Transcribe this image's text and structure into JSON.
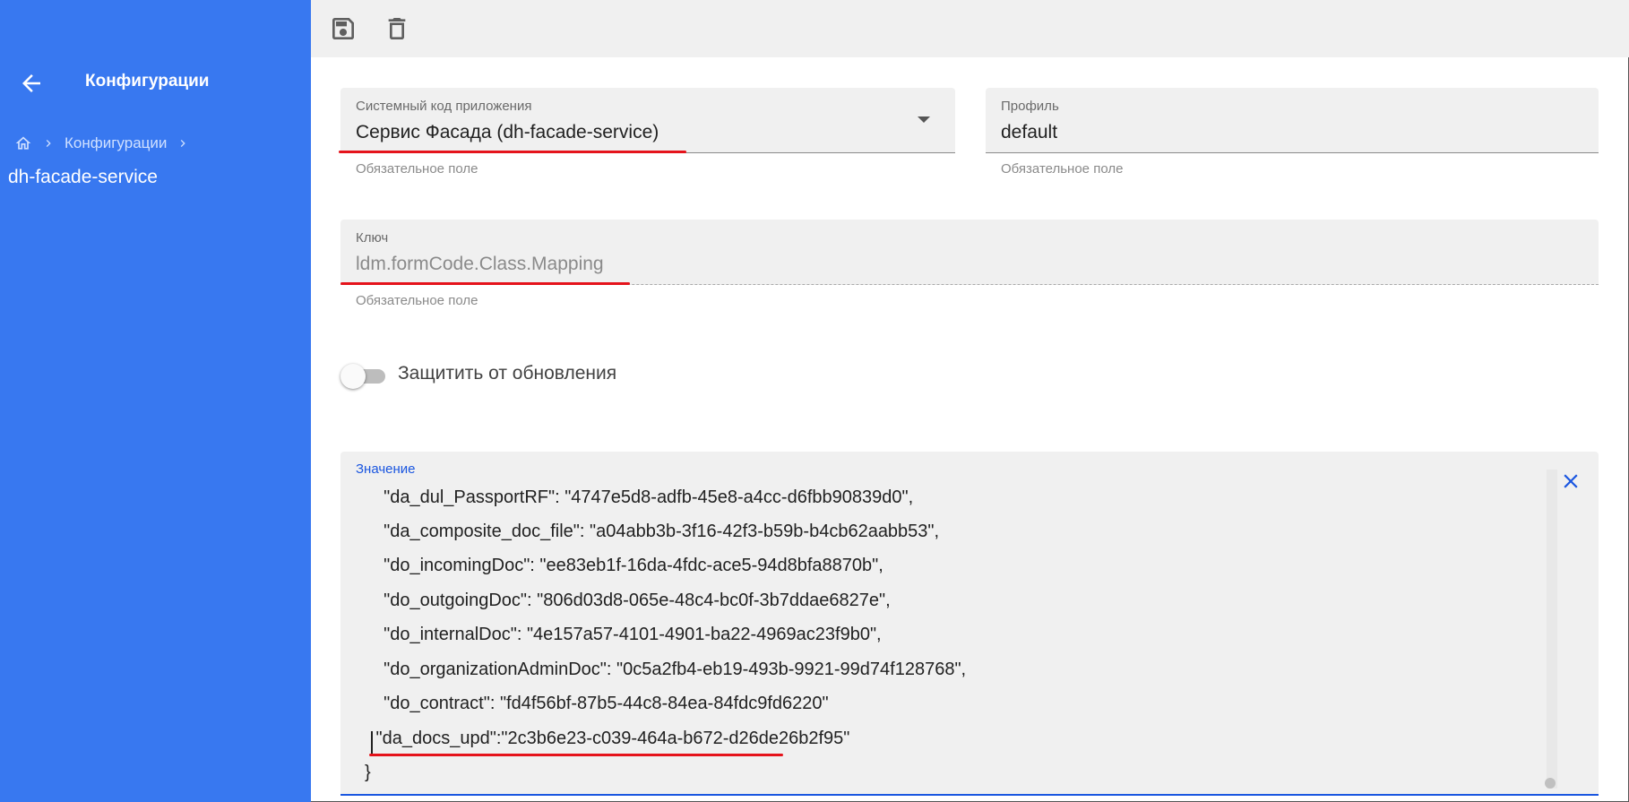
{
  "sidebar": {
    "title": "Конфигурации",
    "breadcrumb_item": "Конфигурации",
    "current": "dh-facade-service",
    "background": "#3878f0"
  },
  "toolbar": {
    "buttons": [
      "save-icon",
      "delete-icon"
    ]
  },
  "form": {
    "app_code": {
      "label": "Системный код приложения",
      "value": "Сервис Фасада (dh-facade-service)",
      "hint": "Обязательное поле"
    },
    "profile": {
      "label": "Профиль",
      "value": "default",
      "hint": "Обязательное поле"
    },
    "key": {
      "label": "Ключ",
      "value": "ldm.formCode.Class.Mapping",
      "hint": "Обязательное поле"
    },
    "protect_toggle": {
      "label": "Защитить от обновления",
      "checked": false
    },
    "value": {
      "label": "Значение",
      "lines": [
        "  \"da_dul_PassportRF\": \"4747e5d8-adfb-45e8-a4cc-d6fbb90839d0\",",
        "  \"da_composite_doc_file\": \"a04abb3b-3f16-42f3-b59b-b4cb62aabb53\",",
        "  \"do_incomingDoc\": \"ee83eb1f-16da-4fdc-ace5-94d8bfa8870b\",",
        "  \"do_outgoingDoc\": \"806d03d8-065e-48c4-bc0f-3b7ddae6827e\",",
        "  \"do_internalDoc\": \"4e157a57-4101-4901-ba22-4969ac23f9b0\",",
        "  \"do_organizationAdminDoc\": \"0c5a2fb4-eb19-493b-9921-99d74f128768\",",
        "  \"do_contract\": \"fd4f56bf-87b5-44c8-84ea-84fdc9fd6220\"",
        " \"da_docs_upd\":\"2c3b6e23-c039-464a-b672-d26de26b2f95\"",
        "}"
      ]
    }
  },
  "colors": {
    "accent": "#1a56e0",
    "annotation": "#e5131b"
  }
}
